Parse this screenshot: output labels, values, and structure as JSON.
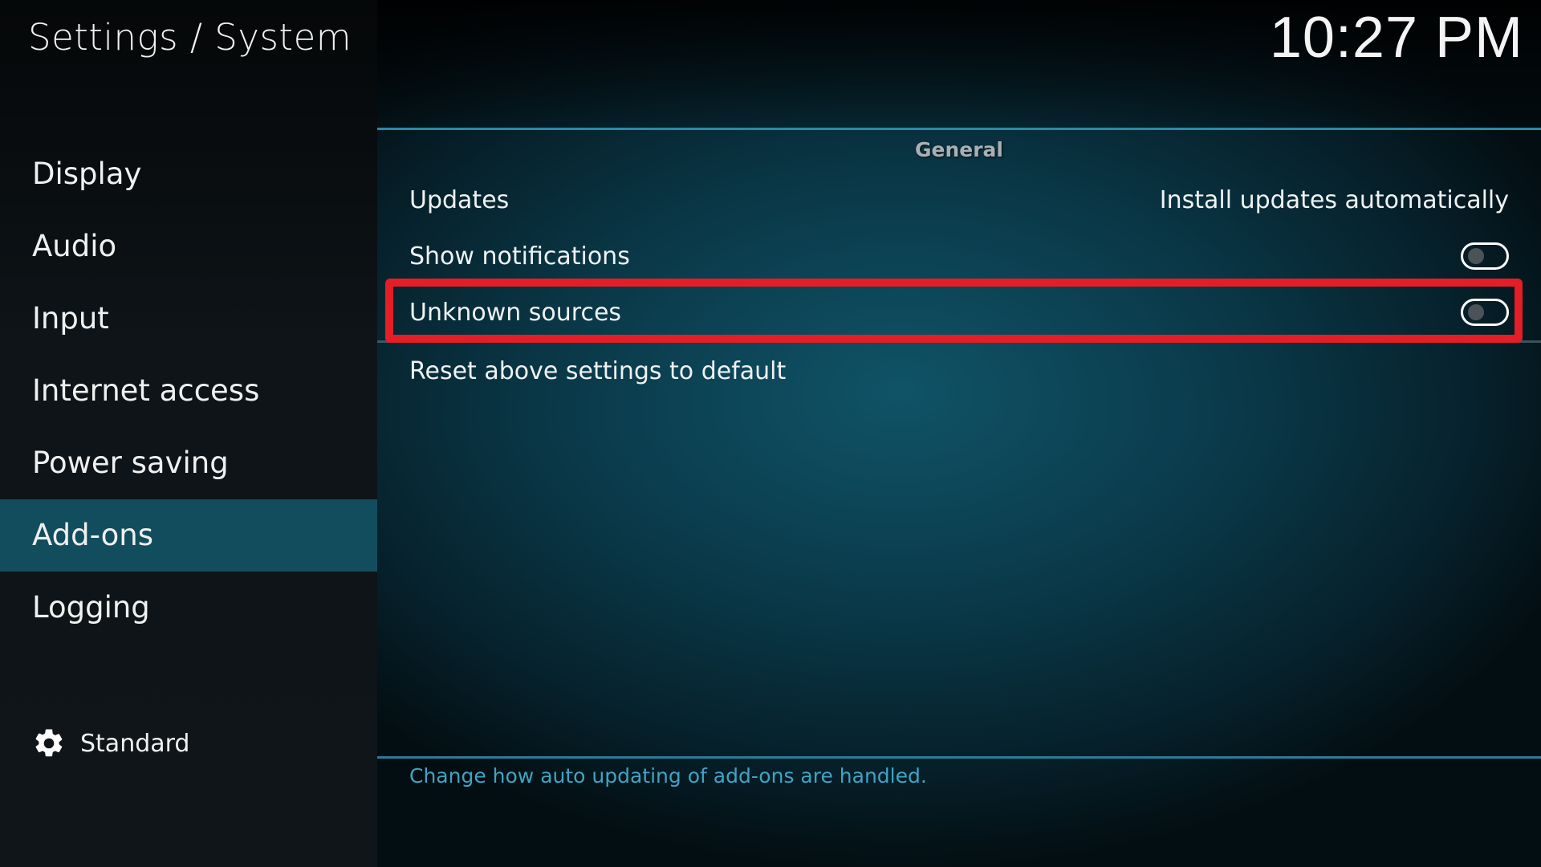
{
  "header": {
    "title": "Settings / System",
    "clock": "10:27 PM"
  },
  "sidebar": {
    "items": [
      {
        "label": "Display",
        "active": false
      },
      {
        "label": "Audio",
        "active": false
      },
      {
        "label": "Input",
        "active": false
      },
      {
        "label": "Internet access",
        "active": false
      },
      {
        "label": "Power saving",
        "active": false
      },
      {
        "label": "Add-ons",
        "active": true
      },
      {
        "label": "Logging",
        "active": false
      }
    ],
    "settings_level": {
      "icon": "gear-icon",
      "label": "Standard"
    }
  },
  "main": {
    "group_title": "General",
    "settings": [
      {
        "label": "Updates",
        "type": "value",
        "value": "Install updates automatically"
      },
      {
        "label": "Show notifications",
        "type": "toggle",
        "enabled": false
      },
      {
        "label": "Unknown sources",
        "type": "toggle",
        "enabled": false,
        "highlighted": true
      },
      {
        "label": "Reset above settings to default",
        "type": "action"
      }
    ],
    "description": "Change how auto updating of add-ons are handled."
  },
  "colors": {
    "accent": "#2b8aa6",
    "active_item_bg": "#124d5e",
    "highlight_box": "#e41e26",
    "description_text": "#3fa4c4"
  }
}
